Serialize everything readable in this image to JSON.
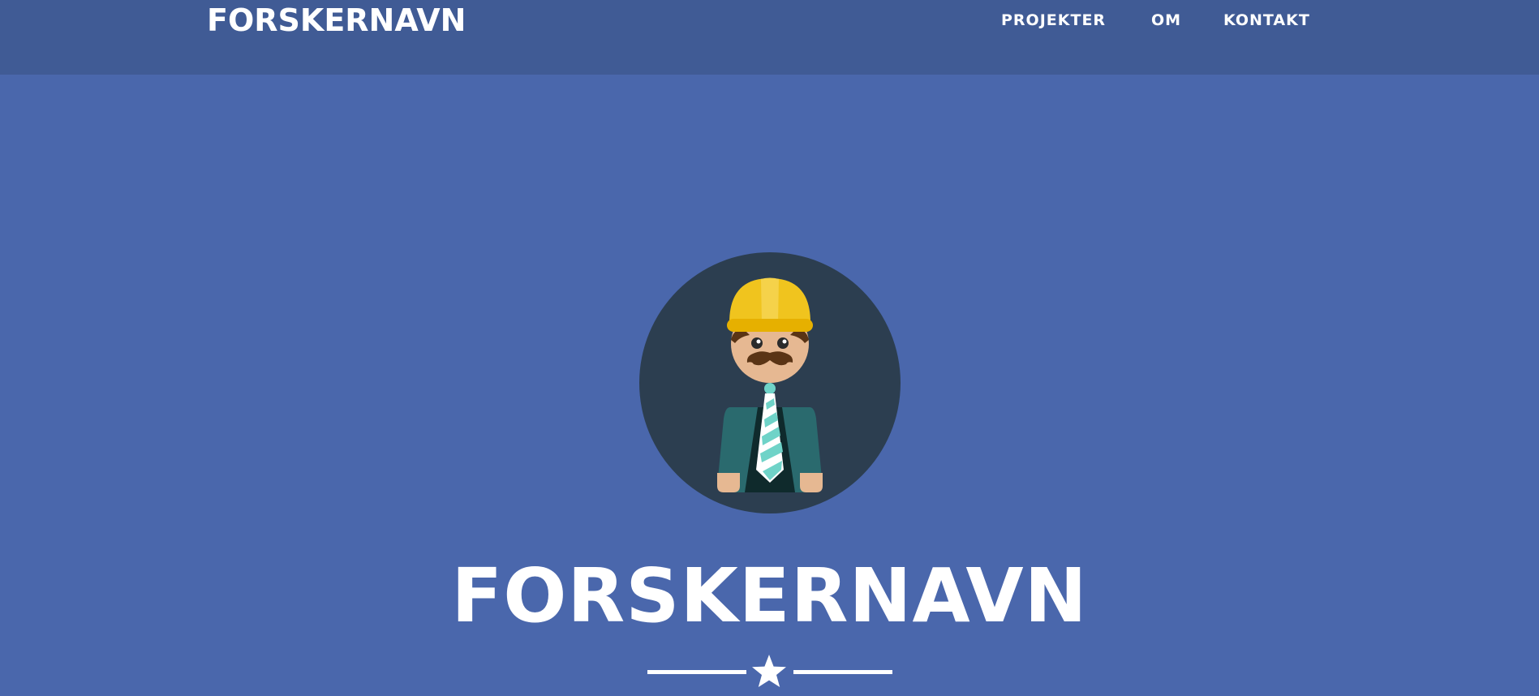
{
  "navbar": {
    "brand": "FORSKERNAVN",
    "links": [
      {
        "label": "PROJEKTER"
      },
      {
        "label": "OM"
      },
      {
        "label": "KONTAKT"
      }
    ]
  },
  "hero": {
    "avatar_icon": "engineer-avatar-icon",
    "title": "FORSKERNAVN",
    "divider_icon": "star-icon"
  },
  "colors": {
    "page_background": "#4a67ac",
    "navbar_background": "#405b95",
    "avatar_circle": "#2c3e50",
    "text": "#ffffff"
  }
}
